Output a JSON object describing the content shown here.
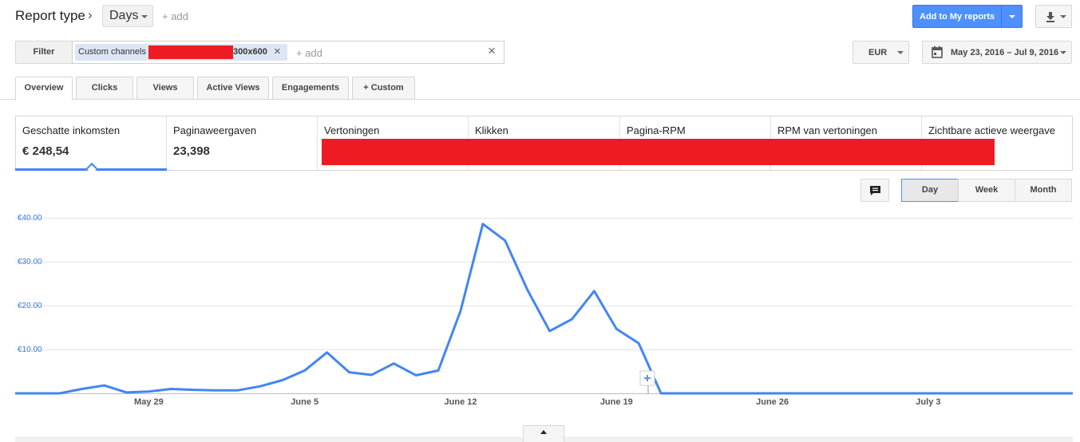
{
  "header": {
    "report_type": "Report type",
    "days_label": "Days",
    "add_label": "+ add",
    "add_to_reports": "Add to My reports"
  },
  "filter": {
    "button": "Filter",
    "chip_label": "Custom channels",
    "chip_suffix": "300x600",
    "add_label": "+ add"
  },
  "currency": "EUR",
  "date_range": "May 23, 2016 – Jul 9, 2016",
  "tabs": [
    "Overview",
    "Clicks",
    "Views",
    "Active Views",
    "Engagements",
    "+ Custom"
  ],
  "metrics": [
    {
      "label": "Geschatte inkomsten",
      "value": "€ 248,54"
    },
    {
      "label": "Paginaweergaven",
      "value": "23,398"
    },
    {
      "label": "Vertoningen",
      "value": ""
    },
    {
      "label": "Klikken",
      "value": ""
    },
    {
      "label": "Pagina-RPM",
      "value": ""
    },
    {
      "label": "RPM van vertoningen",
      "value": ""
    },
    {
      "label": "Zichtbare actieve weergave",
      "value": ""
    }
  ],
  "periods": [
    "Day",
    "Week",
    "Month"
  ],
  "colors": {
    "accent": "#4285f4",
    "redaction": "#ed1c24",
    "primary_button": "#4d90fe"
  },
  "icons": [
    "chevron-right-icon",
    "download-icon",
    "close-icon",
    "calendar-icon",
    "comment-icon",
    "plus-icon",
    "collapse-up-icon"
  ],
  "chart_data": {
    "type": "line",
    "x_start": "May 23, 2016",
    "x_end": "Jul 9, 2016",
    "xticks": [
      "May 29",
      "June 5",
      "June 12",
      "June 19",
      "June 26",
      "July 3"
    ],
    "yticks": [
      "€10.00",
      "€20.00",
      "€30.00",
      "€40.00"
    ],
    "ylim": [
      0,
      40
    ],
    "grid": true,
    "series": [
      {
        "values": [
          0.0,
          0.0,
          0.0,
          1.0,
          1.8,
          0.2,
          0.4,
          1.0,
          0.8,
          0.7,
          0.7,
          1.6,
          3.0,
          5.2,
          9.3,
          4.8,
          4.2,
          6.8,
          4.1,
          5.2,
          18.8,
          38.6,
          34.8,
          23.6,
          14.2,
          16.9,
          23.3,
          14.7,
          11.4,
          0.0,
          0.0,
          0.0,
          0.0,
          0.0,
          0.0,
          0.0,
          0.0,
          0.0,
          0.0,
          0.0,
          0.0,
          0.0,
          0.0,
          0.0,
          0.0,
          0.0,
          0.0,
          0.0
        ]
      }
    ]
  }
}
